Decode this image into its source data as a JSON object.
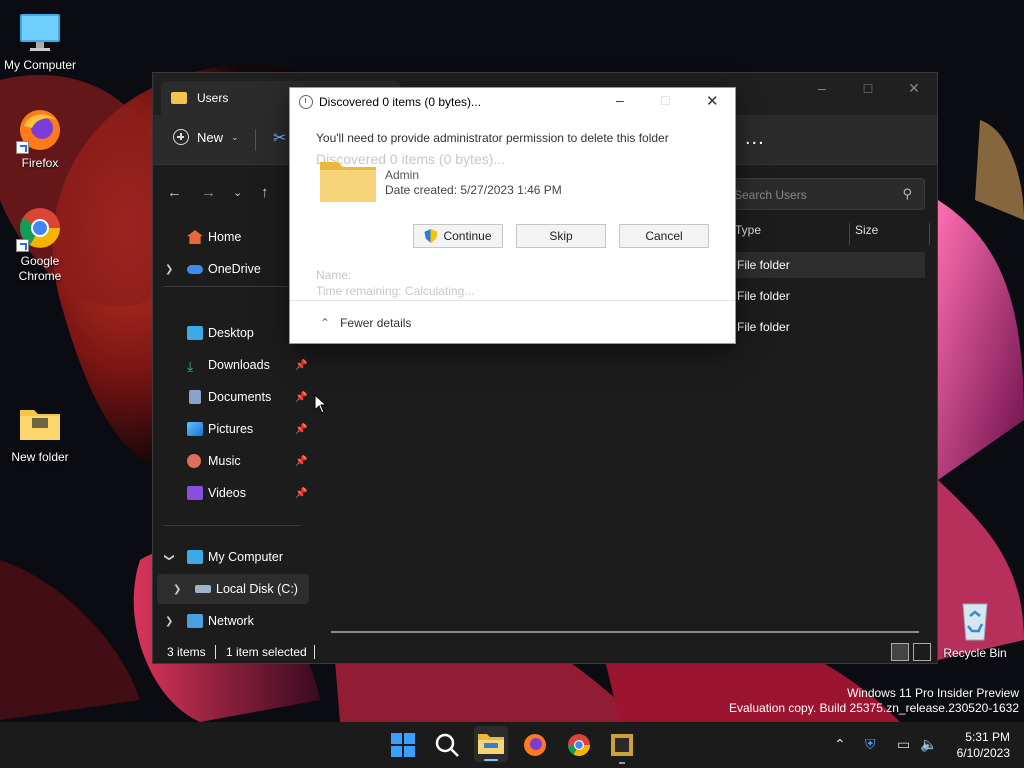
{
  "desktop": {
    "icons": [
      {
        "label": "My Computer"
      },
      {
        "label": "Firefox"
      },
      {
        "label": "Google Chrome"
      },
      {
        "label": "New folder"
      },
      {
        "label": "Recycle Bin"
      }
    ]
  },
  "explorer": {
    "tab_title": "Users",
    "toolbar": {
      "new_label": "New",
      "more_label": "..."
    },
    "search_placeholder": "Search Users",
    "sidebar": {
      "items": [
        {
          "label": "Home"
        },
        {
          "label": "OneDrive"
        },
        {
          "label": "Desktop"
        },
        {
          "label": "Downloads"
        },
        {
          "label": "Documents"
        },
        {
          "label": "Pictures"
        },
        {
          "label": "Music"
        },
        {
          "label": "Videos"
        },
        {
          "label": "My Computer"
        },
        {
          "label": "Local Disk (C:)"
        },
        {
          "label": "Network"
        }
      ]
    },
    "columns": {
      "type": "Type",
      "size": "Size"
    },
    "rows": [
      {
        "type": "File folder"
      },
      {
        "type": "File folder"
      },
      {
        "type": "File folder"
      }
    ],
    "status": {
      "items": "3 items",
      "selected": "1 item selected"
    }
  },
  "dialog": {
    "title": "Discovered 0 items (0 bytes)...",
    "message": "You'll need to provide administrator permission to delete this folder",
    "ghost_heading": "Discovered 0 items (0 bytes)...",
    "item_name": "Admin",
    "item_date": "Date created: 5/27/2023 1:46 PM",
    "buttons": {
      "continue": "Continue",
      "skip": "Skip",
      "cancel": "Cancel"
    },
    "ghost_name": "Name:",
    "ghost_time": "Time remaining:  Calculating...",
    "fewer_details": "Fewer details"
  },
  "watermark": {
    "line1": "Windows 11 Pro Insider Preview",
    "line2": "Evaluation copy. Build 25375.zn_release.230520-1632"
  },
  "taskbar": {
    "time": "5:31 PM",
    "date": "6/10/2023"
  }
}
